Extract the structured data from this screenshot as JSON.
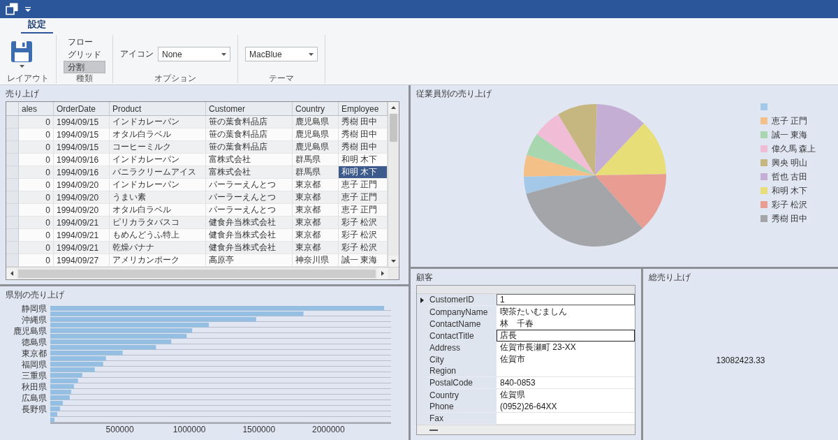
{
  "ribbon": {
    "tabs": [
      {
        "label": "設定",
        "selected": true
      }
    ],
    "groups": [
      {
        "kind": "save",
        "label": "レイアウト"
      },
      {
        "kind": "toggles",
        "label": "種類",
        "buttons": [
          {
            "label": "フロー",
            "selected": false
          },
          {
            "label": "グリッド",
            "selected": false
          },
          {
            "label": "分割",
            "selected": true
          }
        ]
      },
      {
        "kind": "combo",
        "label": "オプション",
        "field_label": "アイコン",
        "value": "None"
      },
      {
        "kind": "combo",
        "label": "テーマ",
        "value": "MacBlue"
      }
    ]
  },
  "sales_grid": {
    "title": "売り上げ",
    "columns": [
      "ales",
      "OrderDate",
      "Product",
      "Customer",
      "Country",
      "Employee"
    ],
    "rows": [
      {
        "cells": [
          "0",
          "1994/09/15",
          "インドカレーパン",
          "笹の葉食料品店",
          "鹿児島県",
          "秀樹 田中"
        ],
        "selected": false
      },
      {
        "cells": [
          "0",
          "1994/09/15",
          "オタル白ラベル",
          "笹の葉食料品店",
          "鹿児島県",
          "秀樹 田中"
        ],
        "selected": false
      },
      {
        "cells": [
          "0",
          "1994/09/15",
          "コーヒーミルク",
          "笹の葉食料品店",
          "鹿児島県",
          "秀樹 田中"
        ],
        "selected": false
      },
      {
        "cells": [
          "0",
          "1994/09/16",
          "インドカレーパン",
          "富株式会社",
          "群馬県",
          "和明 木下"
        ],
        "selected": false
      },
      {
        "cells": [
          "0",
          "1994/09/16",
          "バニラクリームアイス",
          "富株式会社",
          "群馬県",
          "和明 木下"
        ],
        "selected": true
      },
      {
        "cells": [
          "0",
          "1994/09/20",
          "インドカレーパン",
          "パーラーえんとつ",
          "東京都",
          "恵子 正門"
        ],
        "selected": false
      },
      {
        "cells": [
          "0",
          "1994/09/20",
          "うまい素",
          "パーラーえんとつ",
          "東京都",
          "恵子 正門"
        ],
        "selected": false
      },
      {
        "cells": [
          "0",
          "1994/09/20",
          "オタル白ラベル",
          "パーラーえんとつ",
          "東京都",
          "恵子 正門"
        ],
        "selected": false
      },
      {
        "cells": [
          "0",
          "1994/09/21",
          "ピリカラタバスコ",
          "健食弁当株式会社",
          "東京都",
          "彩子 松沢"
        ],
        "selected": false
      },
      {
        "cells": [
          "0",
          "1994/09/21",
          "もめんどうふ特上",
          "健食弁当株式会社",
          "東京都",
          "彩子 松沢"
        ],
        "selected": false
      },
      {
        "cells": [
          "0",
          "1994/09/21",
          "乾燥バナナ",
          "健食弁当株式会社",
          "東京都",
          "彩子 松沢"
        ],
        "selected": false
      },
      {
        "cells": [
          "0",
          "1994/09/27",
          "アメリカンポーク",
          "高原亭",
          "神奈川県",
          "誠一 東海"
        ],
        "selected": false
      }
    ]
  },
  "region_chart": {
    "chart_data": {
      "type": "bar",
      "orientation": "horizontal",
      "title": "県別の売り上げ",
      "categories": [
        "静岡県",
        null,
        "沖縄県",
        null,
        "鹿児島県",
        null,
        "徳島県",
        null,
        "東京都",
        null,
        "福岡県",
        null,
        "三重県",
        null,
        "秋田県",
        null,
        "広島県",
        null,
        "長野県",
        null,
        null
      ],
      "values": [
        2400000,
        1820000,
        1480000,
        1140000,
        1020000,
        980000,
        870000,
        760000,
        520000,
        400000,
        380000,
        320000,
        230000,
        200000,
        170000,
        150000,
        140000,
        90000,
        70000,
        50000,
        30000
      ],
      "xlim": [
        0,
        2450000
      ],
      "xticks": [
        500000,
        1000000,
        1500000,
        2000000
      ]
    }
  },
  "employee_chart": {
    "chart_data": {
      "type": "pie",
      "title": "従業員別の売り上げ",
      "categories": [
        null,
        "恵子 正門",
        "誠一 東海",
        "偉久馬 森上",
        "興央 明山",
        "哲也 古田",
        "和明 木下",
        "彩子 松沢",
        "秀樹 田中"
      ],
      "values": [
        3.9,
        4.9,
        5.2,
        6.5,
        9.1,
        11.6,
        12.7,
        13.6,
        32.5
      ]
    },
    "legend": [
      {
        "color": "#a4c8e8"
      },
      {
        "color": "#f3c187"
      },
      {
        "color": "#a8d6ae"
      },
      {
        "color": "#f1bcd6"
      },
      {
        "color": "#c6b780"
      },
      {
        "color": "#c5aed4"
      },
      {
        "color": "#e7de78"
      },
      {
        "color": "#e99c92"
      },
      {
        "color": "#a4a5a8"
      }
    ]
  },
  "customer": {
    "title": "顧客",
    "fields": [
      {
        "label": "CustomerID",
        "value": "1",
        "selected": true,
        "editing": false
      },
      {
        "label": "CompanyName",
        "value": "喫茶たいむましん",
        "selected": false,
        "editing": false
      },
      {
        "label": "ContactName",
        "value": "林　千春",
        "selected": false,
        "editing": false
      },
      {
        "label": "ContactTitle",
        "value": "店長",
        "selected": false,
        "editing": true
      },
      {
        "label": "Address",
        "value": "佐賀市長瀬町 23-XX",
        "selected": false,
        "editing": false
      },
      {
        "label": "City",
        "value": "佐賀市",
        "selected": false,
        "editing": false
      },
      {
        "label": "Region",
        "selected": false,
        "editing": false
      },
      {
        "label": "PostalCode",
        "value": "840-0853",
        "selected": false,
        "editing": false
      },
      {
        "label": "Country",
        "value": "佐賀県",
        "selected": false,
        "editing": false
      },
      {
        "label": "Phone",
        "value": "(0952)26-64XX",
        "selected": false,
        "editing": false
      },
      {
        "label": "Fax",
        "selected": false,
        "editing": false
      }
    ]
  },
  "total_sales": {
    "title": "総売り上げ",
    "value": "13082423.33"
  }
}
